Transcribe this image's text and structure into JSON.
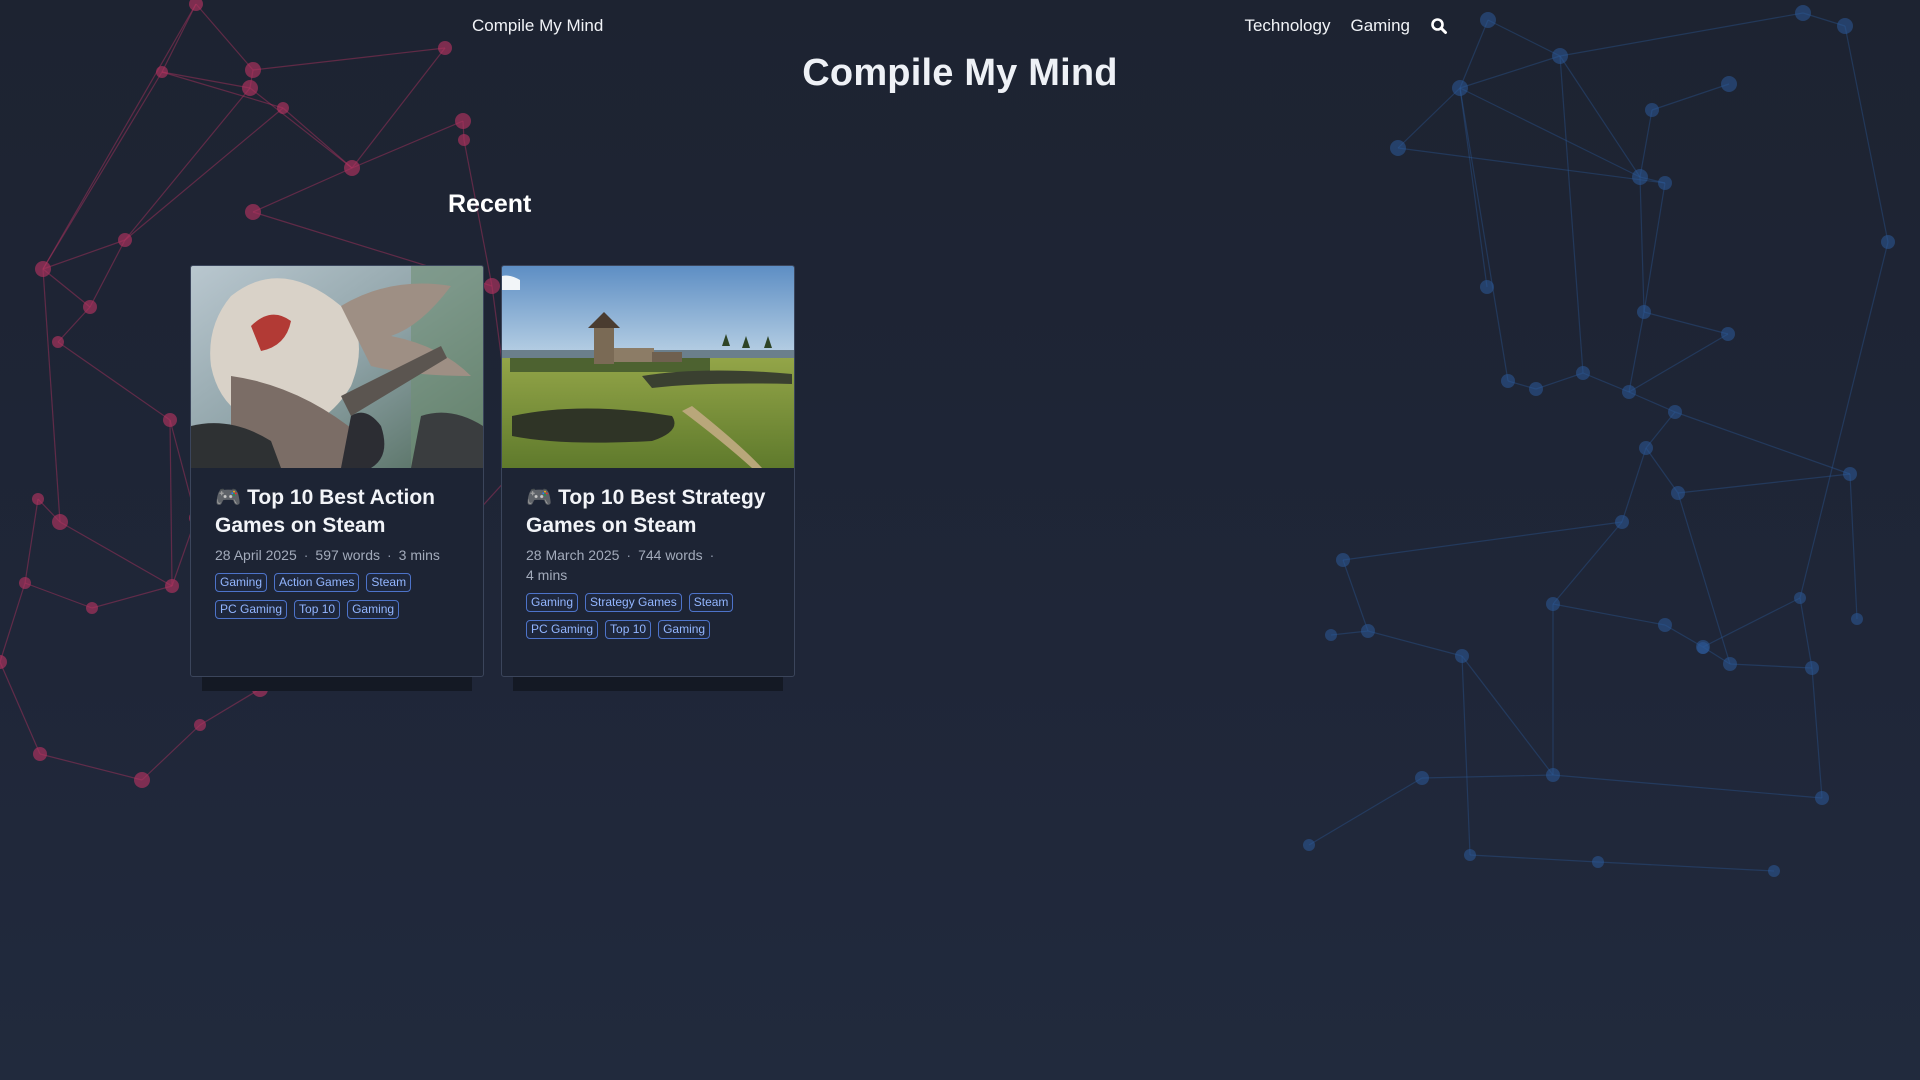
{
  "nav": {
    "brand": "Compile My Mind",
    "links": [
      "Technology",
      "Gaming"
    ],
    "search_icon": "search-icon"
  },
  "site_title": "Compile My Mind",
  "section_heading": "Recent",
  "posts": [
    {
      "emoji": "🎮",
      "title": "Top 10 Best Action Games on Steam",
      "date": "28 April 2025",
      "words": "597 words",
      "read_time": "3 mins",
      "tags": [
        "Gaming",
        "Action Games",
        "Steam",
        "PC Gaming",
        "Top 10",
        "Gaming"
      ],
      "thumbnail": "monster-hunter-dragon-artwork"
    },
    {
      "emoji": "🎮",
      "title": "Top 10 Best Strategy Games on Steam",
      "date": "28 March 2025",
      "words": "744 words",
      "read_time": "4 mins",
      "tags": [
        "Gaming",
        "Strategy Games",
        "Steam",
        "PC Gaming",
        "Top 10",
        "Gaming"
      ],
      "thumbnail": "medieval-army-field-tower"
    }
  ],
  "colors": {
    "background": "#1d2331",
    "accent_tag": "#93b6ff",
    "network_left": "#b0335f",
    "network_right": "#2b5a99"
  }
}
